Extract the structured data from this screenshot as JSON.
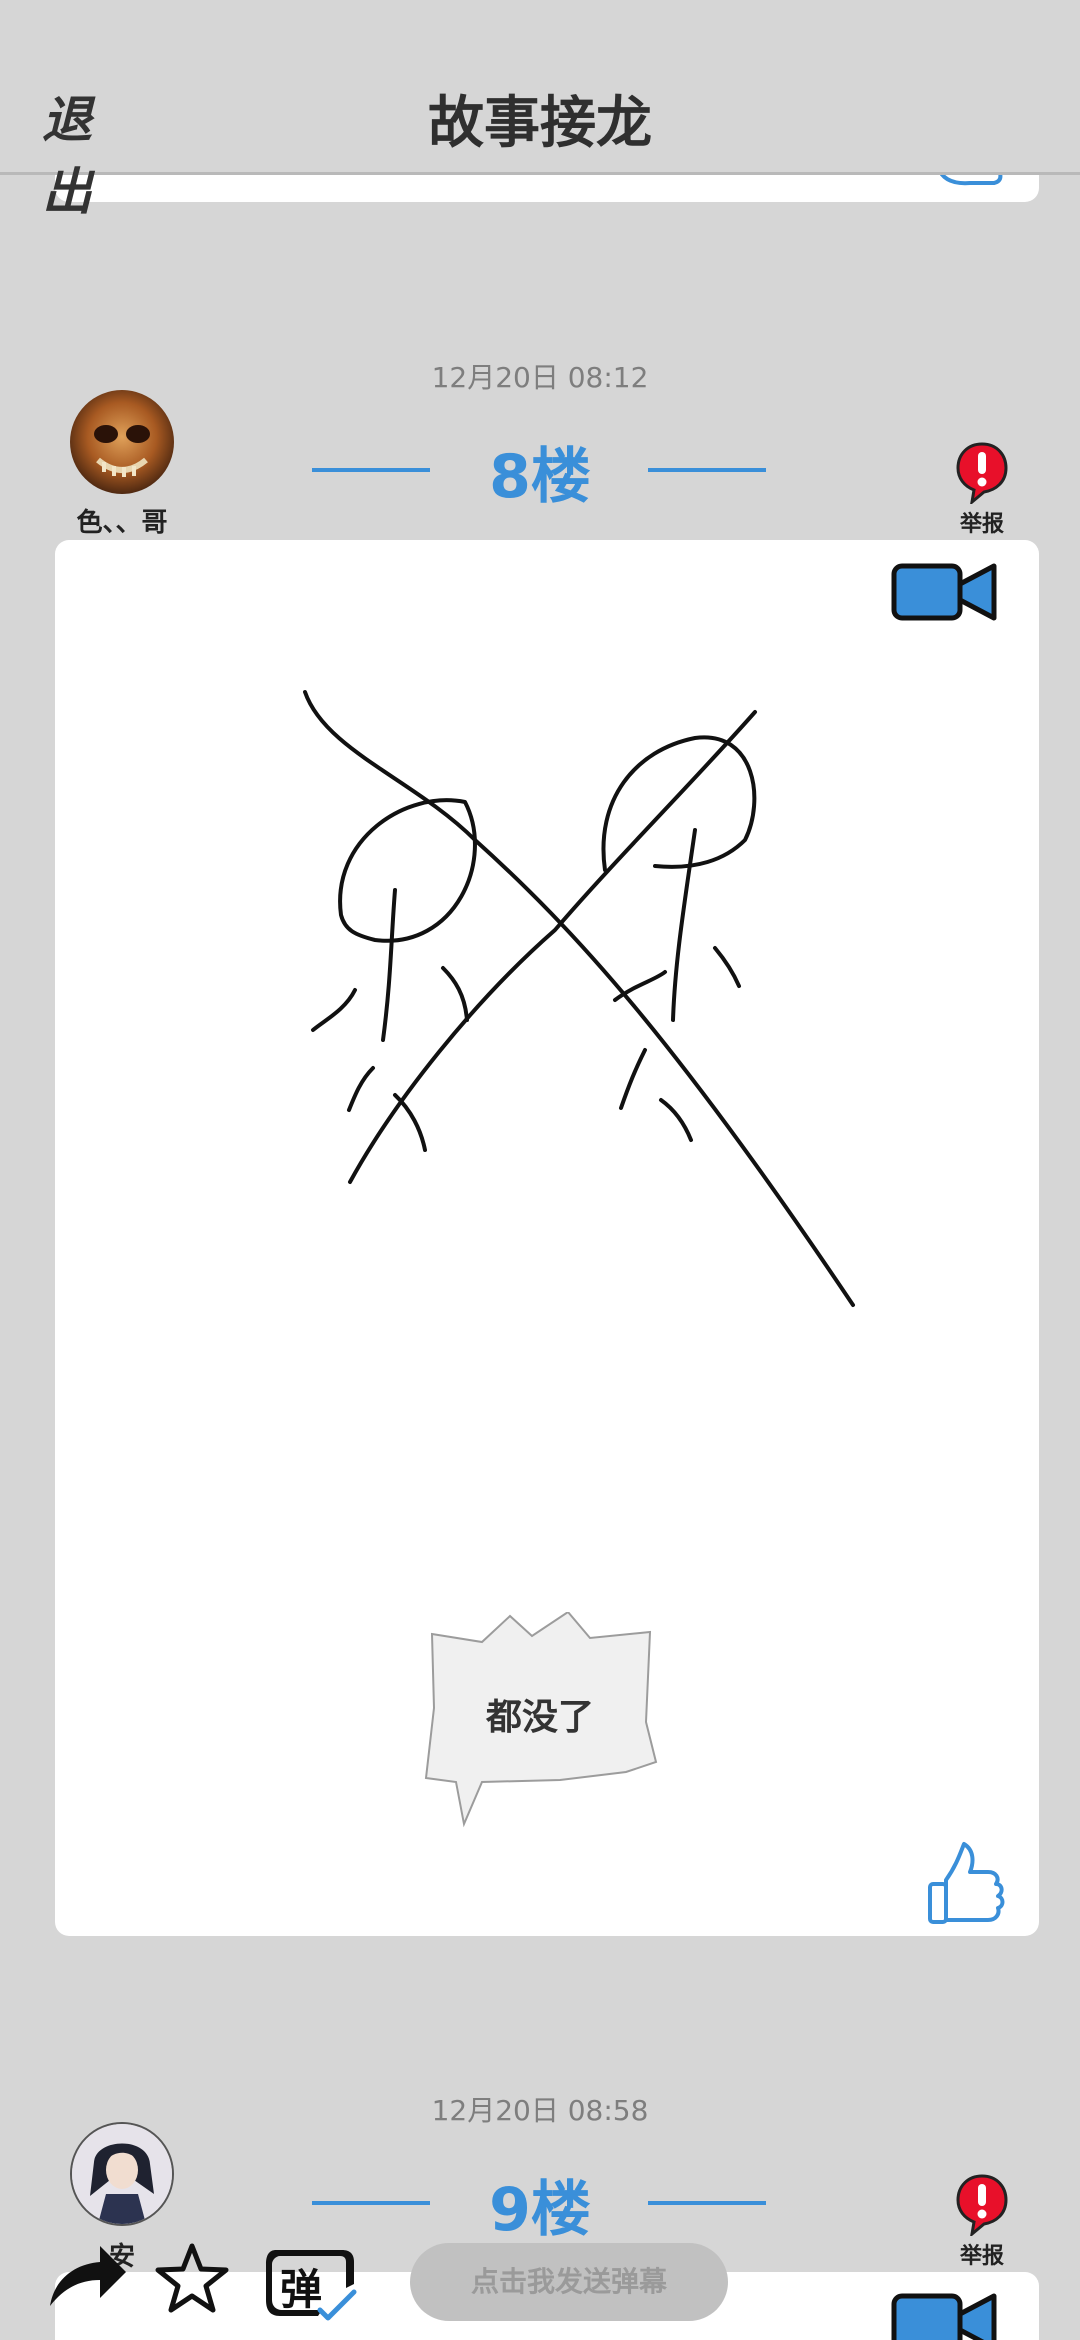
{
  "header": {
    "exit_label": "退出",
    "title": "故事接龙"
  },
  "posts": [
    {
      "time": "12月20日  08:12",
      "floor": "8楼",
      "username": "色、、哥",
      "report_label": "举报",
      "speech": "都没了"
    },
    {
      "time": "12月20日  08:58",
      "floor": "9楼",
      "username": "安",
      "report_label": "举报"
    }
  ],
  "toolbar": {
    "danmu_placeholder": "点击我发送弹幕",
    "danmu_toggle_char": "弹"
  },
  "colors": {
    "accent": "#3a8fd9",
    "report_red": "#e8102a",
    "background": "#d6d6d6"
  },
  "icons": [
    "share-icon",
    "star-icon",
    "danmu-toggle-icon",
    "camera-icon",
    "thumb-up-icon",
    "report-icon"
  ]
}
